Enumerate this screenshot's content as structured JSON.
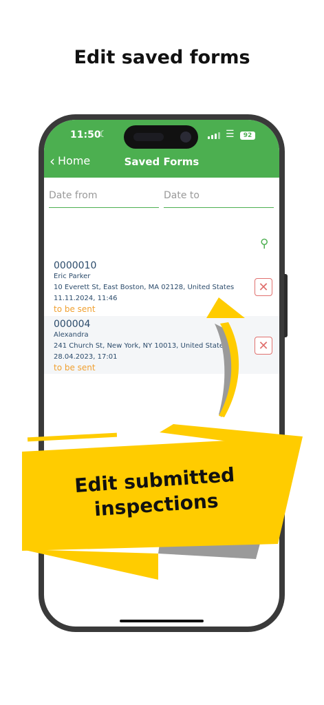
{
  "headline": "Edit saved forms",
  "status_bar": {
    "time": "11:50",
    "battery": "92"
  },
  "appbar": {
    "back_label": "Home",
    "title": "Saved Forms"
  },
  "filters": {
    "date_from_placeholder": "Date from",
    "date_to_placeholder": "Date to"
  },
  "forms": [
    {
      "number": "0000010",
      "name": "Eric Parker",
      "address": "10 Everett St, East Boston, MA  02128, United States",
      "datetime": "11.11.2024, 11:46",
      "status": "to be sent"
    },
    {
      "number": "000004",
      "name": "Alexandra",
      "address": "241 Church St, New York, NY  10013, United States",
      "datetime": "28.04.2023, 17:01",
      "status": "to be sent"
    }
  ],
  "banner": {
    "line1": "Edit submitted",
    "line2": "inspections"
  },
  "colors": {
    "green": "#4caf50",
    "yellow": "#ffcc00",
    "status_orange": "#f0a030",
    "delete_red": "#e0706e"
  },
  "icons": [
    "moon-icon",
    "signal-icon",
    "wifi-icon",
    "battery-icon",
    "chevron-left-icon",
    "search-icon",
    "close-icon",
    "arrow-icon"
  ]
}
